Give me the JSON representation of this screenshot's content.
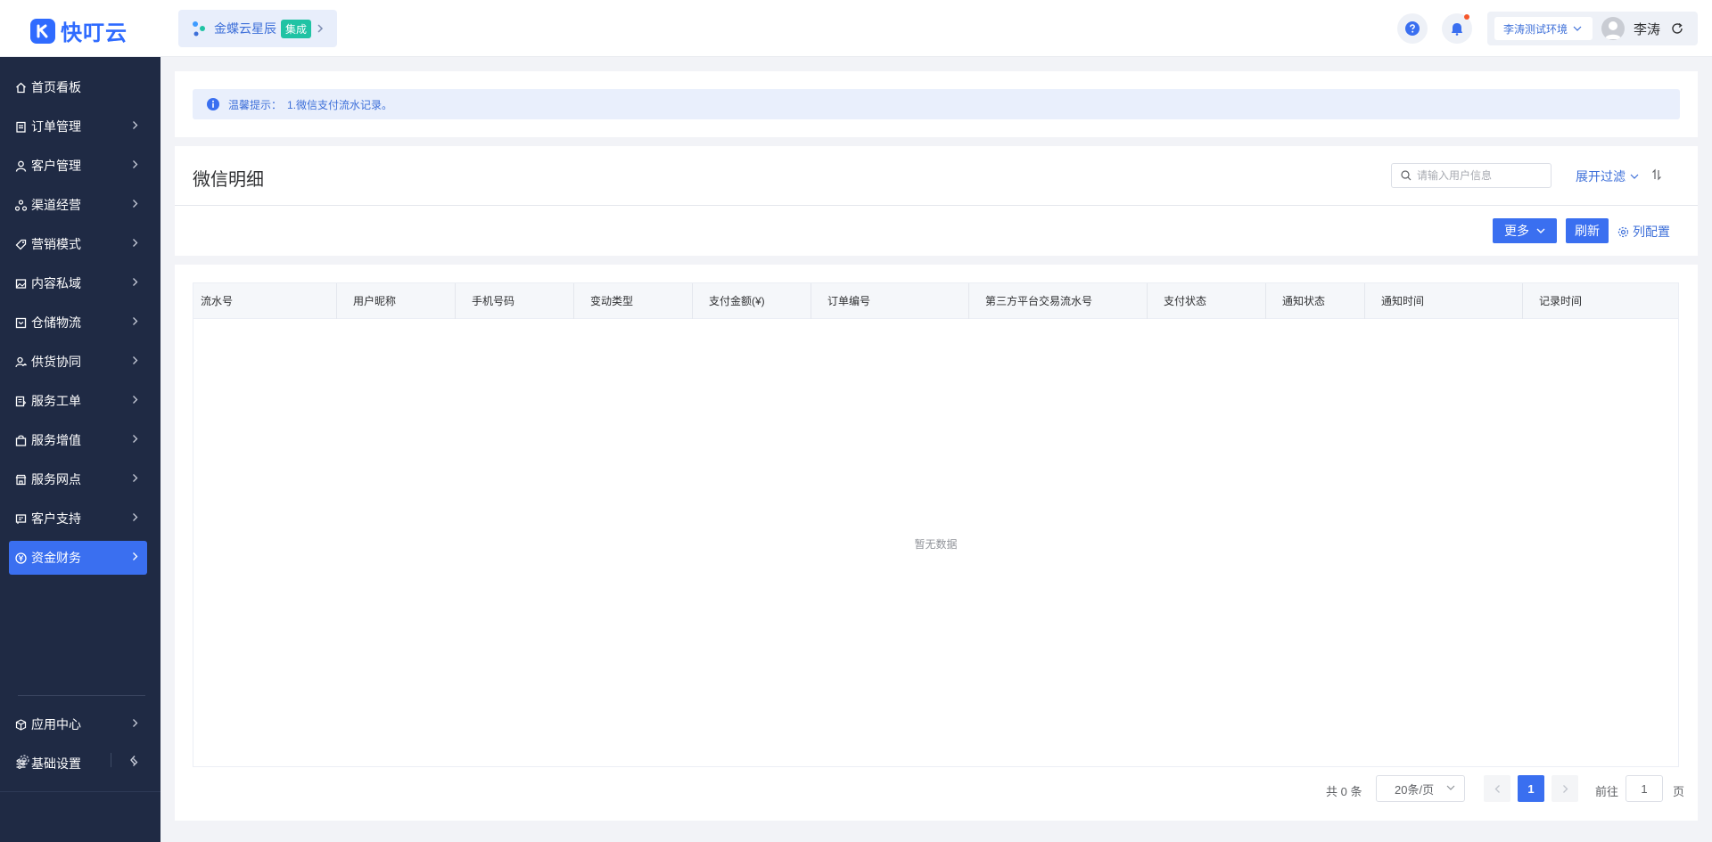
{
  "app": {
    "logo_text": "快叮云"
  },
  "header": {
    "brand_name": "金蝶云星辰",
    "brand_tag": "集成",
    "env_label": "李涛测试环境",
    "user_name": "李涛"
  },
  "sidebar": {
    "items": [
      {
        "label": "首页看板",
        "icon": "home-icon",
        "has_arrow": false
      },
      {
        "label": "订单管理",
        "icon": "clipboard-icon",
        "has_arrow": true
      },
      {
        "label": "客户管理",
        "icon": "user-icon",
        "has_arrow": true
      },
      {
        "label": "渠道经营",
        "icon": "network-icon",
        "has_arrow": true
      },
      {
        "label": "营销模式",
        "icon": "tag-icon",
        "has_arrow": true
      },
      {
        "label": "内容私域",
        "icon": "image-icon",
        "has_arrow": true
      },
      {
        "label": "仓储物流",
        "icon": "box-icon",
        "has_arrow": true
      },
      {
        "label": "供货协同",
        "icon": "user-sync-icon",
        "has_arrow": true
      },
      {
        "label": "服务工单",
        "icon": "ticket-icon",
        "has_arrow": true
      },
      {
        "label": "服务增值",
        "icon": "bag-icon",
        "has_arrow": true
      },
      {
        "label": "服务网点",
        "icon": "store-icon",
        "has_arrow": true
      },
      {
        "label": "客户支持",
        "icon": "support-icon",
        "has_arrow": true
      },
      {
        "label": "资金财务",
        "icon": "yuan-icon",
        "has_arrow": true,
        "active": true
      }
    ],
    "bottom_items": [
      {
        "label": "应用中心",
        "icon": "cube-icon"
      },
      {
        "label": "基础设置",
        "icon": "sliders-icon"
      }
    ]
  },
  "tip": {
    "label": "温馨提示：",
    "message": "1.微信支付流水记录。"
  },
  "page": {
    "title": "微信明细",
    "search_placeholder": "请输入用户信息",
    "expand_filter": "展开过滤",
    "more_button": "更多",
    "refresh_button": "刷新",
    "column_config": "列配置"
  },
  "table": {
    "columns": [
      "流水号",
      "用户昵称",
      "手机号码",
      "变动类型",
      "支付金额(¥)",
      "订单编号",
      "第三方平台交易流水号",
      "支付状态",
      "通知状态",
      "通知时间",
      "记录时间"
    ],
    "empty_text": "暂无数据"
  },
  "pagination": {
    "total": "共 0 条",
    "page_size": "20条/页",
    "current_page": "1",
    "goto_label": "前往",
    "goto_value": "1",
    "page_suffix": "页"
  },
  "colors": {
    "primary": "#3a6ff0",
    "sidebar_bg": "#1f2a44",
    "tip_bg": "#e9effc",
    "brand_tag": "#20c3a4"
  }
}
